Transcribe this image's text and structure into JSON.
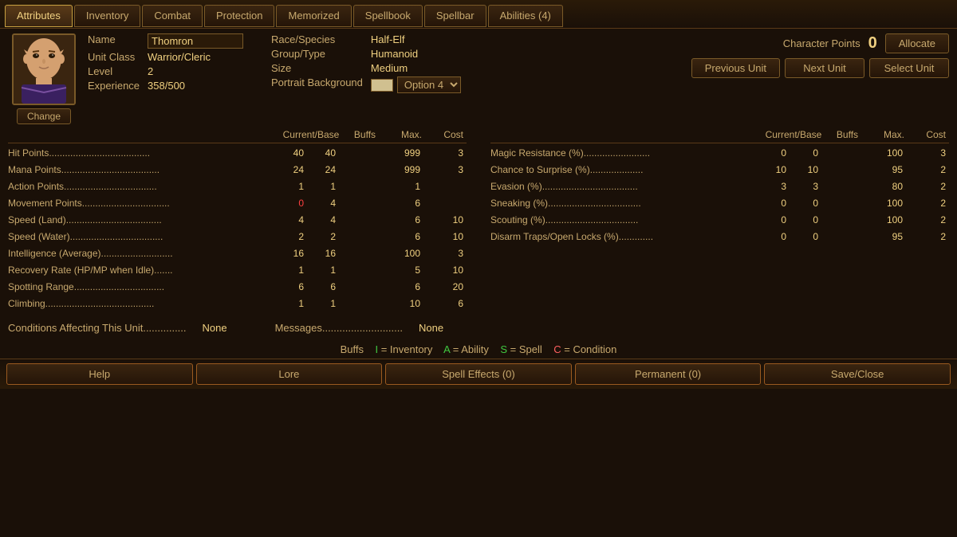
{
  "tabs": [
    {
      "id": "attributes",
      "label": "Attributes",
      "active": true
    },
    {
      "id": "inventory",
      "label": "Inventory",
      "active": false
    },
    {
      "id": "combat",
      "label": "Combat",
      "active": false
    },
    {
      "id": "protection",
      "label": "Protection",
      "active": false
    },
    {
      "id": "memorized",
      "label": "Memorized",
      "active": false
    },
    {
      "id": "spellbook",
      "label": "Spellbook",
      "active": false
    },
    {
      "id": "spellbar",
      "label": "Spellbar",
      "active": false
    },
    {
      "id": "abilities",
      "label": "Abilities (4)",
      "active": false
    }
  ],
  "character": {
    "name": "Thomron",
    "unit_class": "Warrior/Cleric",
    "level": "2",
    "experience": "358/500",
    "race_species": "Half-Elf",
    "group_type": "Humanoid",
    "size": "Medium",
    "portrait_background": "Option 4"
  },
  "labels": {
    "name": "Name",
    "unit_class": "Unit Class",
    "level": "Level",
    "experience": "Experience",
    "race_species": "Race/Species",
    "group_type": "Group/Type",
    "size": "Size",
    "portrait_background": "Portrait Background",
    "character_points": "Character Points",
    "change": "Change",
    "allocate": "Allocate",
    "previous_unit": "Previous Unit",
    "next_unit": "Next Unit",
    "select_unit": "Select Unit"
  },
  "character_points": "0",
  "stats_headers": {
    "col1": "Current/Base",
    "col2": "Buffs",
    "col3": "Max.",
    "col4": "Cost"
  },
  "left_stats": [
    {
      "name": "Hit Points......................................",
      "current": "40",
      "base": "40",
      "buffs": "",
      "max": "999",
      "cost": "3",
      "current_red": false
    },
    {
      "name": "Mana Points.....................................",
      "current": "24",
      "base": "24",
      "buffs": "",
      "max": "999",
      "cost": "3",
      "current_red": false
    },
    {
      "name": "Action Points...................................",
      "current": "1",
      "base": "1",
      "buffs": "",
      "max": "1",
      "cost": "",
      "current_red": false
    },
    {
      "name": "Movement Points.................................",
      "current": "0",
      "base": "4",
      "buffs": "",
      "max": "6",
      "cost": "",
      "current_red": true
    },
    {
      "name": "Speed (Land)....................................",
      "current": "4",
      "base": "4",
      "buffs": "",
      "max": "6",
      "cost": "10",
      "current_red": false
    },
    {
      "name": "Speed (Water)...................................",
      "current": "2",
      "base": "2",
      "buffs": "",
      "max": "6",
      "cost": "10",
      "current_red": false
    },
    {
      "name": "Intelligence (Average)...........................",
      "current": "16",
      "base": "16",
      "buffs": "",
      "max": "100",
      "cost": "3",
      "current_red": false
    },
    {
      "name": "Recovery Rate (HP/MP when Idle).......",
      "current": "1",
      "base": "1",
      "buffs": "",
      "max": "5",
      "cost": "10",
      "current_red": false
    },
    {
      "name": "Spotting Range..................................",
      "current": "6",
      "base": "6",
      "buffs": "",
      "max": "6",
      "cost": "20",
      "current_red": false
    },
    {
      "name": "Climbing.........................................",
      "current": "1",
      "base": "1",
      "buffs": "",
      "max": "10",
      "cost": "6",
      "current_red": false
    }
  ],
  "right_stats": [
    {
      "name": "Magic Resistance (%).........................",
      "current": "0",
      "base": "0",
      "buffs": "",
      "max": "100",
      "cost": "3"
    },
    {
      "name": "Chance to Surprise (%)....................",
      "current": "10",
      "base": "10",
      "buffs": "",
      "max": "95",
      "cost": "2"
    },
    {
      "name": "Evasion (%)....................................",
      "current": "3",
      "base": "3",
      "buffs": "",
      "max": "80",
      "cost": "2"
    },
    {
      "name": "Sneaking (%)...................................",
      "current": "0",
      "base": "0",
      "buffs": "",
      "max": "100",
      "cost": "2"
    },
    {
      "name": "Scouting (%)...................................",
      "current": "0",
      "base": "0",
      "buffs": "",
      "max": "100",
      "cost": "2"
    },
    {
      "name": "Disarm Traps/Open Locks (%).............",
      "current": "0",
      "base": "0",
      "buffs": "",
      "max": "95",
      "cost": "2"
    }
  ],
  "conditions": {
    "label": "Conditions Affecting This Unit...............",
    "value": "None",
    "messages_label": "Messages............................",
    "messages_value": "None"
  },
  "buffs_legend": {
    "prefix": "Buffs",
    "items": [
      {
        "key": "I",
        "desc": "= Inventory"
      },
      {
        "key": "A",
        "desc": "= Ability"
      },
      {
        "key": "S",
        "desc": "= Spell"
      },
      {
        "key": "C",
        "desc": "= Condition"
      }
    ]
  },
  "bottom_buttons": [
    {
      "id": "help",
      "label": "Help"
    },
    {
      "id": "lore",
      "label": "Lore"
    },
    {
      "id": "spell-effects",
      "label": "Spell Effects (0)"
    },
    {
      "id": "permanent",
      "label": "Permanent (0)"
    },
    {
      "id": "save-close",
      "label": "Save/Close"
    }
  ]
}
